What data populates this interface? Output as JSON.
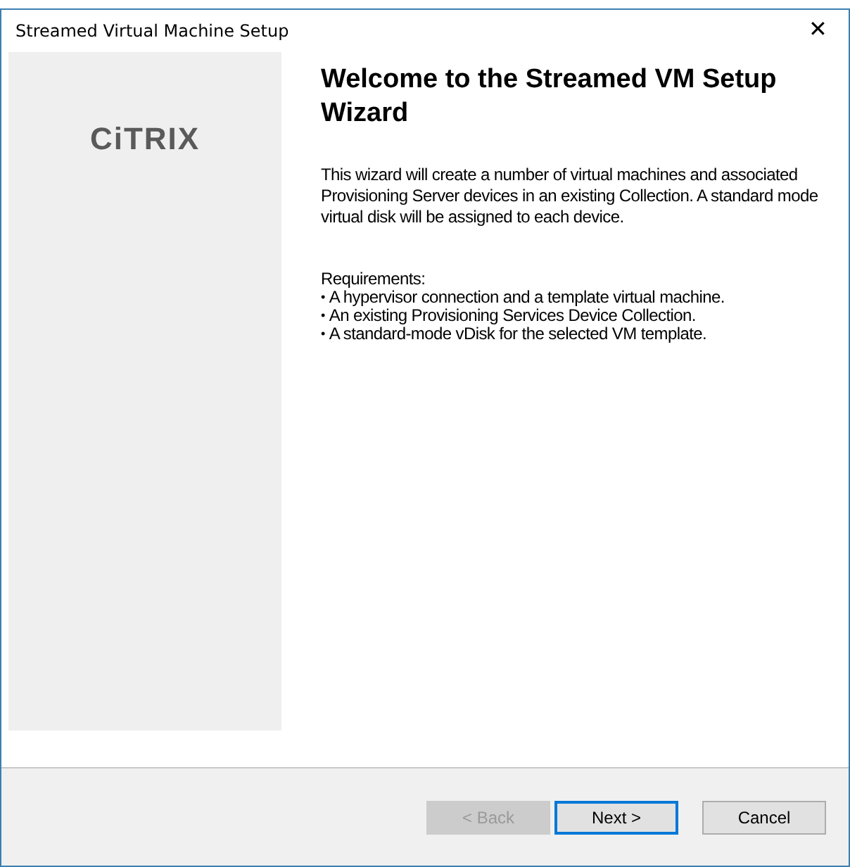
{
  "window": {
    "title": "Streamed Virtual Machine Setup",
    "close": "✕"
  },
  "sidebar": {
    "logo": "CiTRIX"
  },
  "heading": "Welcome to the Streamed VM Setup Wizard",
  "intro": "This wizard will create a number of virtual machines and associated Provisioning Server devices in an existing Collection. A standard mode virtual disk will be assigned to each device.",
  "requirements": {
    "title": "Requirements:",
    "items": [
      {
        "bullet": "•",
        "text": "A hypervisor connection and a template virtual machine."
      },
      {
        "bullet": "•",
        "text": "An existing Provisioning Services Device Collection."
      },
      {
        "bullet": "•",
        "text": "A standard-mode vDisk for the selected VM template."
      }
    ]
  },
  "buttons": [
    {
      "label": "< Back",
      "disabled": true,
      "default": false
    },
    {
      "label": "Next >",
      "disabled": false,
      "default": true
    },
    {
      "label": "Cancel",
      "disabled": false,
      "default": false
    }
  ]
}
